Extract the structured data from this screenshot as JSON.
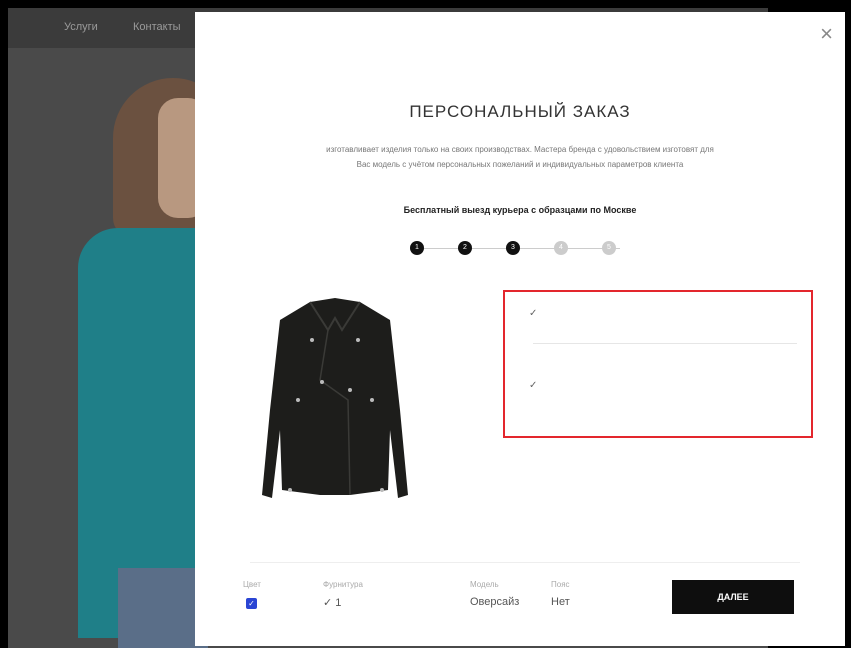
{
  "background": {
    "nav": [
      "Услуги",
      "Контакты"
    ]
  },
  "modal": {
    "title": "ПЕРСОНАЛЬНЫЙ ЗАКАЗ",
    "close_label": "×",
    "description": "изготавливает изделия только на своих производствах. Мастера бренда с удовольствием изготовят для Вас модель с учётом персональных пожеланий и индивидуальных параметров клиента",
    "delivery": "Бесплатный выезд курьера с образцами по Москве",
    "steps": [
      "1",
      "2",
      "3",
      "4",
      "5"
    ],
    "current_step": 3,
    "options": [
      {
        "check": "✓"
      },
      {
        "check": "✓"
      }
    ],
    "summary": {
      "color_label": "Цвет",
      "hardware_label": "Фурнитура",
      "hardware_value": "✓ 1",
      "model_label": "Модель",
      "model_value": "Оверсайз",
      "fur_label": "Пояс",
      "fur_value": "Нет"
    },
    "next_label": "ДАЛЕЕ"
  },
  "colors": {
    "accent_border": "#e3262d",
    "button": "#0e0e0e",
    "checkbox": "#2a45d4"
  }
}
